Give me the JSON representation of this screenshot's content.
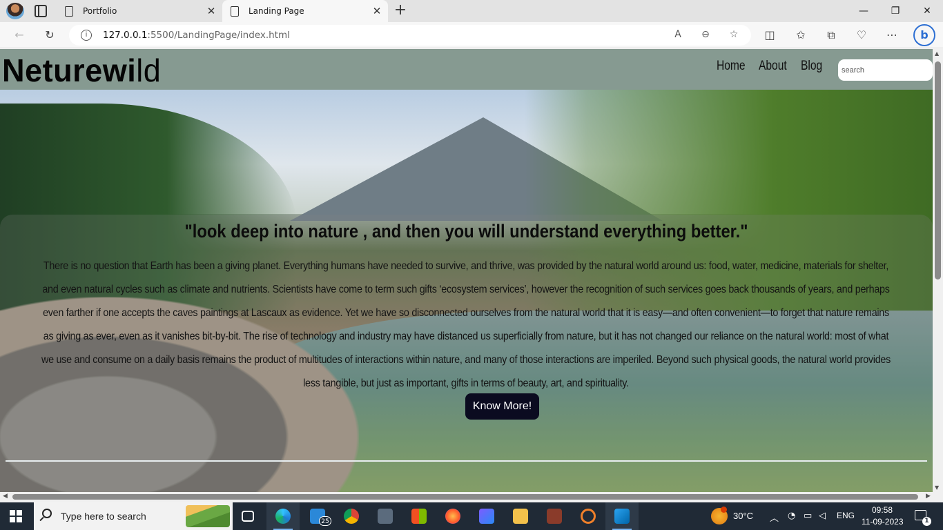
{
  "browser": {
    "tabs": [
      {
        "title": "Portfolio",
        "active": false
      },
      {
        "title": "Landing Page",
        "active": true
      }
    ],
    "address": {
      "host": "127.0.0.1",
      "path": ":5500/LandingPage/index.html"
    },
    "window_controls": {
      "minimize": "—",
      "restore": "❐",
      "close": "✕"
    }
  },
  "site": {
    "brand": {
      "bold": "Neturewi",
      "light": "ld"
    },
    "nav": [
      "Home",
      "About",
      "Blog"
    ],
    "search_placeholder": "search",
    "quote": "\"look deep into nature , and then you will understand everything better.\"",
    "body": "There is no question that Earth has been a giving planet. Everything humans have needed to survive, and thrive, was provided by the natural world around us: food, water, medicine, materials for shelter, and even natural cycles such as climate and nutrients. Scientists have come to term such gifts ‘ecosystem services’, however the recognition of such services goes back thousands of years, and perhaps even farther if one accepts the caves paintings at Lascaux as evidence. Yet we have so disconnected ourselves from the natural world that it is easy—and often convenient—to forget that nature remains as giving as ever, even as it vanishes bit-by-bit. The rise of technology and industry may have distanced us superficially from nature, but it has not changed our reliance on the natural world: most of what we use and consume on a daily basis remains the product of multitudes of interactions within nature, and many of those interactions are imperiled. Beyond such physical goods, the natural world provides less tangible, but just as important, gifts in terms of beauty, art, and spirituality.",
    "cta": "Know More!"
  },
  "taskbar": {
    "search_placeholder": "Type here to search",
    "mail_badge": "25",
    "weather": "30°C",
    "language": "ENG",
    "time": "09:58",
    "date": "11-09-2023",
    "notification_count": "1"
  }
}
